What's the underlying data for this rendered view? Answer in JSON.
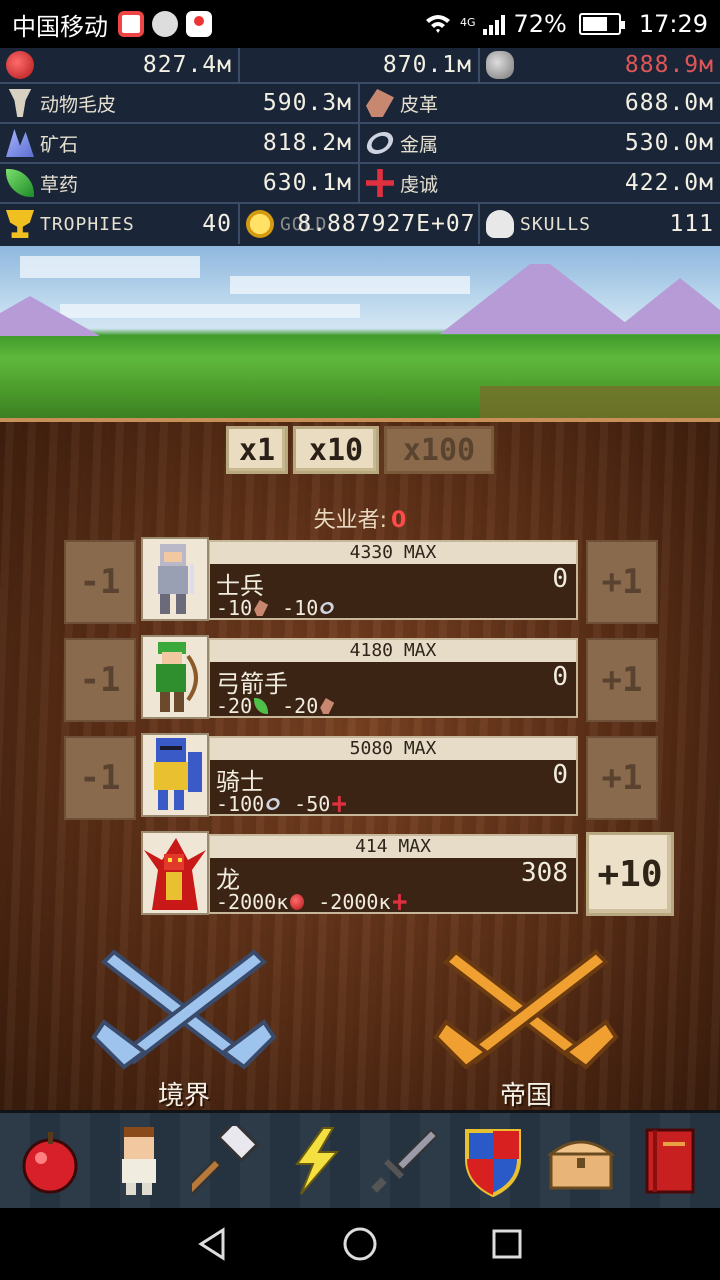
{
  "status_bar": {
    "carrier": "中国移动",
    "network": "4G",
    "battery": "72%",
    "battery_level": 0.72,
    "time": "17:29"
  },
  "resources": {
    "food": {
      "icon": "apple-icon",
      "value": "827.4м"
    },
    "wood": {
      "icon": "wood-log-icon",
      "value": "870.1м"
    },
    "stone": {
      "icon": "stone-icon",
      "value": "888.9м",
      "value_color": "#e05555"
    },
    "fur": {
      "icon": "fur-icon",
      "label": "动物毛皮",
      "value": "590.3м"
    },
    "leather": {
      "icon": "leather-icon",
      "label": "皮革",
      "value": "688.0м"
    },
    "ore": {
      "icon": "ore-icon",
      "label": "矿石",
      "value": "818.2м"
    },
    "metal": {
      "icon": "metal-ring-icon",
      "label": "金属",
      "value": "530.0м"
    },
    "herbs": {
      "icon": "herb-leaf-icon",
      "label": "草药",
      "value": "630.1м"
    },
    "faith": {
      "icon": "faith-cross-icon",
      "label": "虔诚",
      "value": "422.0м"
    },
    "trophies": {
      "icon": "trophy-icon",
      "label": "TROPHIES",
      "value": "40"
    },
    "gold": {
      "icon": "gold-coin-icon",
      "label": "GOLD",
      "value": "8.887927E+07"
    },
    "skulls": {
      "icon": "skull-icon",
      "label": "SKULLS",
      "value": "111"
    }
  },
  "multipliers": [
    {
      "label": "x1",
      "active": true
    },
    {
      "label": "x10",
      "active": true
    },
    {
      "label": "x100",
      "active": false
    }
  ],
  "idle": {
    "label": "失业者:",
    "value": "0"
  },
  "units": [
    {
      "name": "士兵",
      "max": "4330 MAX",
      "count": "0",
      "minus": "-1",
      "plus": "+1",
      "costs": [
        {
          "amount": "-10",
          "icon": "leather-icon"
        },
        {
          "amount": "-10",
          "icon": "metal-ring-icon"
        }
      ]
    },
    {
      "name": "弓箭手",
      "max": "4180 MAX",
      "count": "0",
      "minus": "-1",
      "plus": "+1",
      "costs": [
        {
          "amount": "-20",
          "icon": "herb-leaf-icon"
        },
        {
          "amount": "-20",
          "icon": "leather-icon"
        }
      ]
    },
    {
      "name": "骑士",
      "max": "5080 MAX",
      "count": "0",
      "minus": "-1",
      "plus": "+1",
      "costs": [
        {
          "amount": "-100",
          "icon": "metal-ring-icon"
        },
        {
          "amount": "-50",
          "icon": "faith-cross-icon"
        }
      ]
    },
    {
      "name": "龙",
      "max": "414 MAX",
      "count": "308",
      "plus": "+10",
      "costs": [
        {
          "amount": "-2000ĸ",
          "icon": "apple-icon"
        },
        {
          "amount": "-2000ĸ",
          "icon": "faith-cross-icon"
        }
      ]
    }
  ],
  "actions": {
    "realm": "境界",
    "empire": "帝国"
  },
  "toolbar": [
    "apple-icon",
    "worker-icon",
    "hammer-icon",
    "lightning-icon",
    "sword-icon",
    "shield-icon",
    "chest-icon",
    "book-icon"
  ],
  "colors": {
    "wood": "#5a2e16",
    "panel": "#1a2638",
    "accent_red": "#ff4a4a",
    "button_light": "#e9dcc0"
  }
}
